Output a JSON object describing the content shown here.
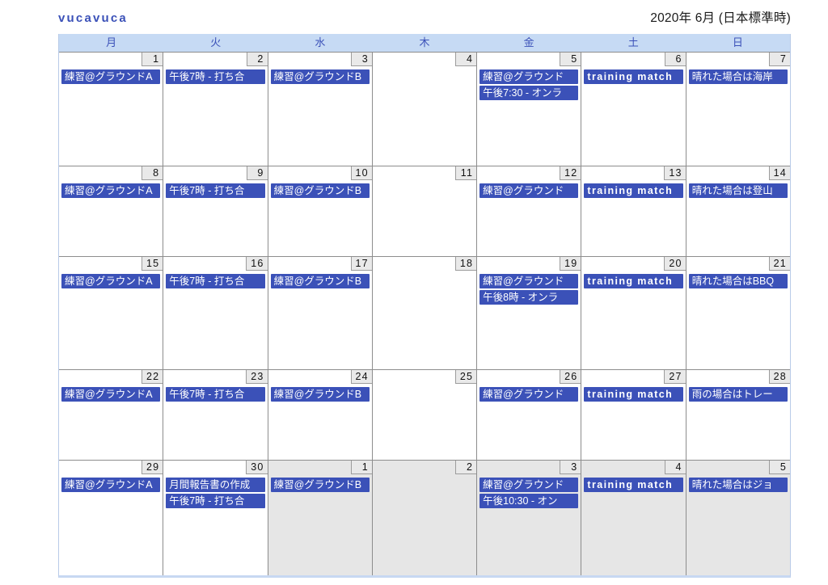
{
  "header": {
    "brand": "vucavuca",
    "period": "2020年 6月 (日本標準時)"
  },
  "weekdays": [
    {
      "label": "月"
    },
    {
      "label": "火"
    },
    {
      "label": "水"
    },
    {
      "label": "木"
    },
    {
      "label": "金"
    },
    {
      "label": "土"
    },
    {
      "label": "日"
    }
  ],
  "colors": {
    "brand": "#3b51b8",
    "event_bar": "#3b51b8",
    "weekday_header_bg": "#c6daf4",
    "weekday_header_text": "#3b51b8",
    "daynum_badge_bg": "#e9e9e9",
    "outside_month_bg": "#e6e6e6",
    "grid_line": "#8d8d8d",
    "frame_bottom": "#c7d8f2"
  },
  "weeks": [
    {
      "days": [
        {
          "num": "1",
          "outside": false,
          "events": [
            {
              "title": "練習@グラウンドA",
              "latin": false
            }
          ]
        },
        {
          "num": "2",
          "outside": false,
          "events": [
            {
              "title": "午後7時 - 打ち合",
              "latin": false
            }
          ]
        },
        {
          "num": "3",
          "outside": false,
          "events": [
            {
              "title": "練習@グラウンドB",
              "latin": false
            }
          ]
        },
        {
          "num": "4",
          "outside": false,
          "events": []
        },
        {
          "num": "5",
          "outside": false,
          "events": [
            {
              "title": "練習@グラウンド",
              "latin": false
            },
            {
              "title": "午後7:30 - オンラ",
              "latin": false
            }
          ]
        },
        {
          "num": "6",
          "outside": false,
          "events": [
            {
              "title": "training match",
              "latin": true
            }
          ]
        },
        {
          "num": "7",
          "outside": false,
          "events": [
            {
              "title": "晴れた場合は海岸",
              "latin": false
            }
          ]
        }
      ]
    },
    {
      "days": [
        {
          "num": "8",
          "outside": false,
          "events": [
            {
              "title": "練習@グラウンドA",
              "latin": false
            }
          ]
        },
        {
          "num": "9",
          "outside": false,
          "events": [
            {
              "title": "午後7時 - 打ち合",
              "latin": false
            }
          ]
        },
        {
          "num": "10",
          "outside": false,
          "events": [
            {
              "title": "練習@グラウンドB",
              "latin": false
            }
          ]
        },
        {
          "num": "11",
          "outside": false,
          "events": []
        },
        {
          "num": "12",
          "outside": false,
          "events": [
            {
              "title": "練習@グラウンド",
              "latin": false
            }
          ]
        },
        {
          "num": "13",
          "outside": false,
          "events": [
            {
              "title": "training match",
              "latin": true
            }
          ]
        },
        {
          "num": "14",
          "outside": false,
          "events": [
            {
              "title": "晴れた場合は登山",
              "latin": false
            }
          ]
        }
      ]
    },
    {
      "days": [
        {
          "num": "15",
          "outside": false,
          "events": [
            {
              "title": "練習@グラウンドA",
              "latin": false
            }
          ]
        },
        {
          "num": "16",
          "outside": false,
          "events": [
            {
              "title": "午後7時 - 打ち合",
              "latin": false
            }
          ]
        },
        {
          "num": "17",
          "outside": false,
          "events": [
            {
              "title": "練習@グラウンドB",
              "latin": false
            }
          ]
        },
        {
          "num": "18",
          "outside": false,
          "events": []
        },
        {
          "num": "19",
          "outside": false,
          "events": [
            {
              "title": "練習@グラウンド",
              "latin": false
            },
            {
              "title": "午後8時 - オンラ",
              "latin": false
            }
          ]
        },
        {
          "num": "20",
          "outside": false,
          "events": [
            {
              "title": "training match",
              "latin": true
            }
          ]
        },
        {
          "num": "21",
          "outside": false,
          "events": [
            {
              "title": "晴れた場合はBBQ",
              "latin": false
            }
          ]
        }
      ]
    },
    {
      "days": [
        {
          "num": "22",
          "outside": false,
          "events": [
            {
              "title": "練習@グラウンドA",
              "latin": false
            }
          ]
        },
        {
          "num": "23",
          "outside": false,
          "events": [
            {
              "title": "午後7時 - 打ち合",
              "latin": false
            }
          ]
        },
        {
          "num": "24",
          "outside": false,
          "events": [
            {
              "title": "練習@グラウンドB",
              "latin": false
            }
          ]
        },
        {
          "num": "25",
          "outside": false,
          "events": []
        },
        {
          "num": "26",
          "outside": false,
          "events": [
            {
              "title": "練習@グラウンド",
              "latin": false
            }
          ]
        },
        {
          "num": "27",
          "outside": false,
          "events": [
            {
              "title": "training match",
              "latin": true
            }
          ]
        },
        {
          "num": "28",
          "outside": false,
          "events": [
            {
              "title": "雨の場合はトレー",
              "latin": false
            }
          ]
        }
      ]
    },
    {
      "days": [
        {
          "num": "29",
          "outside": false,
          "events": [
            {
              "title": "練習@グラウンドA",
              "latin": false
            }
          ]
        },
        {
          "num": "30",
          "outside": false,
          "events": [
            {
              "title": "月間報告書の作成",
              "latin": false
            },
            {
              "title": "午後7時 - 打ち合",
              "latin": false
            }
          ]
        },
        {
          "num": "1",
          "outside": true,
          "events": [
            {
              "title": "練習@グラウンドB",
              "latin": false
            }
          ]
        },
        {
          "num": "2",
          "outside": true,
          "events": []
        },
        {
          "num": "3",
          "outside": true,
          "events": [
            {
              "title": "練習@グラウンド",
              "latin": false
            },
            {
              "title": "午後10:30 - オン",
              "latin": false
            }
          ]
        },
        {
          "num": "4",
          "outside": true,
          "events": [
            {
              "title": "training match",
              "latin": true
            }
          ]
        },
        {
          "num": "5",
          "outside": true,
          "events": [
            {
              "title": "晴れた場合はジョ",
              "latin": false
            }
          ]
        }
      ]
    }
  ]
}
